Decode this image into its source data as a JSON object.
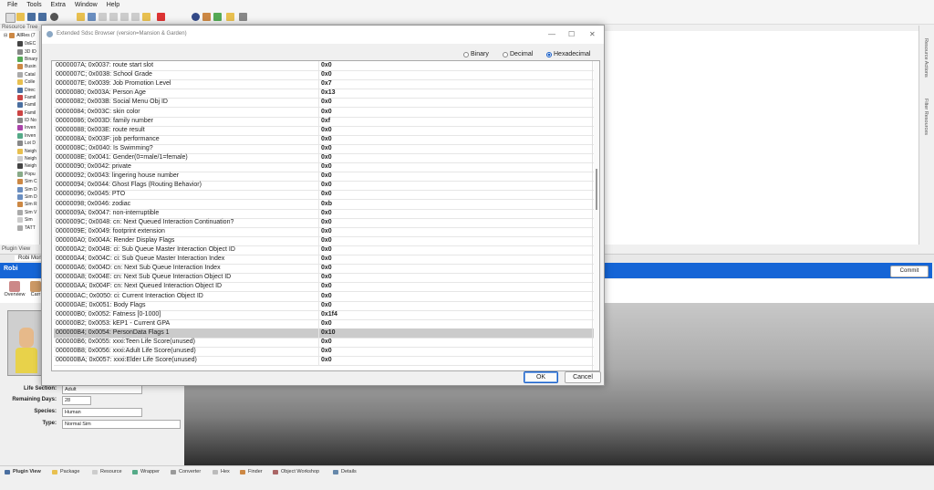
{
  "menu": [
    "File",
    "Tools",
    "Extra",
    "Window",
    "Help"
  ],
  "resource_tree": {
    "title": "Resource Tree",
    "root": "AllRes (7",
    "items": [
      "0xEC",
      "3D ID",
      "Binary",
      "Busin",
      "Catal",
      "Colle",
      "Direc",
      "Famil",
      "Famil",
      "Famil",
      "ID No",
      "Inven",
      "Inven",
      "Lot D",
      "Neigh",
      "Neigh",
      "Neigh",
      "Popu",
      "Sim C",
      "Sim D",
      "Sim D",
      "Sim R",
      "Sim V",
      "Sim",
      "TATT"
    ]
  },
  "side_tabs": [
    "Resource Actions",
    "Filter Resources"
  ],
  "plugin_view": {
    "title": "Plugin View",
    "tab": "Robi Moni",
    "sim_name": "Robi",
    "commit_label": "Commit",
    "toolbar": [
      "Overview",
      "Carr"
    ],
    "fields": [
      {
        "label": "Life Section:",
        "value": "Adult"
      },
      {
        "label": "Remaining Days:",
        "value": "28"
      },
      {
        "label": "Species:",
        "value": "Human"
      },
      {
        "label": "Type:",
        "value": "Normal Sim"
      }
    ]
  },
  "bottom_tabs": [
    "Plugin View",
    "Package",
    "Resource",
    "Wrapper",
    "Converter",
    "Hex",
    "Finder",
    "Object Workshop",
    "Details"
  ],
  "dialog": {
    "title": "Extended Sdsc Browser (version=Mansion & Garden)",
    "radio_options": [
      "Binary",
      "Decimal",
      "Hexadecimal"
    ],
    "selected_radio": "Hexadecimal",
    "ok_label": "OK",
    "cancel_label": "Cancel",
    "selected_row_index": 29,
    "rows": [
      {
        "name": "0000007A; 0x0037: route start slot",
        "value": "0x0"
      },
      {
        "name": "0000007C; 0x0038: School Grade",
        "value": "0x0"
      },
      {
        "name": "0000007E; 0x0039: Job Promotion Level",
        "value": "0x7"
      },
      {
        "name": "00000080; 0x003A: Person Age",
        "value": "0x13"
      },
      {
        "name": "00000082; 0x003B: Social Menu Obj ID",
        "value": "0x0"
      },
      {
        "name": "00000084; 0x003C: skin color",
        "value": "0x0"
      },
      {
        "name": "00000086; 0x003D: family number",
        "value": "0xf"
      },
      {
        "name": "00000088; 0x003E: route result",
        "value": "0x0"
      },
      {
        "name": "0000008A; 0x003F: job performance",
        "value": "0x0"
      },
      {
        "name": "0000008C; 0x0040: Is Swimming?",
        "value": "0x0"
      },
      {
        "name": "0000008E; 0x0041: Gender(0=male/1=female)",
        "value": "0x0"
      },
      {
        "name": "00000090; 0x0042: private",
        "value": "0x0"
      },
      {
        "name": "00000092; 0x0043: lingering house number",
        "value": "0x0"
      },
      {
        "name": "00000094; 0x0044: Ghost Flags (Routing Behavior)",
        "value": "0x0"
      },
      {
        "name": "00000096; 0x0045: PTO",
        "value": "0x0"
      },
      {
        "name": "00000098; 0x0046: zodiac",
        "value": "0xb"
      },
      {
        "name": "0000009A; 0x0047: non-interruptible",
        "value": "0x0"
      },
      {
        "name": "0000009C; 0x0048: cn: Next Queued Interaction Continuation?",
        "value": "0x0"
      },
      {
        "name": "0000009E; 0x0049: footprint extension",
        "value": "0x0"
      },
      {
        "name": "000000A0; 0x004A: Render Display Flags",
        "value": "0x0"
      },
      {
        "name": "000000A2; 0x004B: ci: Sub Queue Master Interaction Object ID",
        "value": "0x0"
      },
      {
        "name": "000000A4; 0x004C: ci: Sub Queue Master Interaction Index",
        "value": "0x0"
      },
      {
        "name": "000000A6; 0x004D: cn: Next Sub Queue Interaction Index",
        "value": "0x0"
      },
      {
        "name": "000000A8; 0x004E: cn: Next Sub Queue Interaction Object ID",
        "value": "0x0"
      },
      {
        "name": "000000AA; 0x004F: cn: Next Queued Interaction Object ID",
        "value": "0x0"
      },
      {
        "name": "000000AC; 0x0050: ci: Current Interaction Object ID",
        "value": "0x0"
      },
      {
        "name": "000000AE; 0x0051: Body Flags",
        "value": "0x0"
      },
      {
        "name": "000000B0; 0x0052: Fatness [0-1000]",
        "value": "0x1f4"
      },
      {
        "name": "000000B2; 0x0053: kEP1 - Current GPA",
        "value": "0x0"
      },
      {
        "name": "000000B4; 0x0054: PersonData Flags 1",
        "value": "0x10"
      },
      {
        "name": "000000B6; 0x0055: xxxi:Teen Life Score(unused)",
        "value": "0x0"
      },
      {
        "name": "000000B8; 0x0056: xxxi:Adult Life Score(unused)",
        "value": "0x0"
      },
      {
        "name": "000000BA; 0x0057: xxxi:Elder Life Score(unused)",
        "value": "0x0"
      }
    ]
  }
}
